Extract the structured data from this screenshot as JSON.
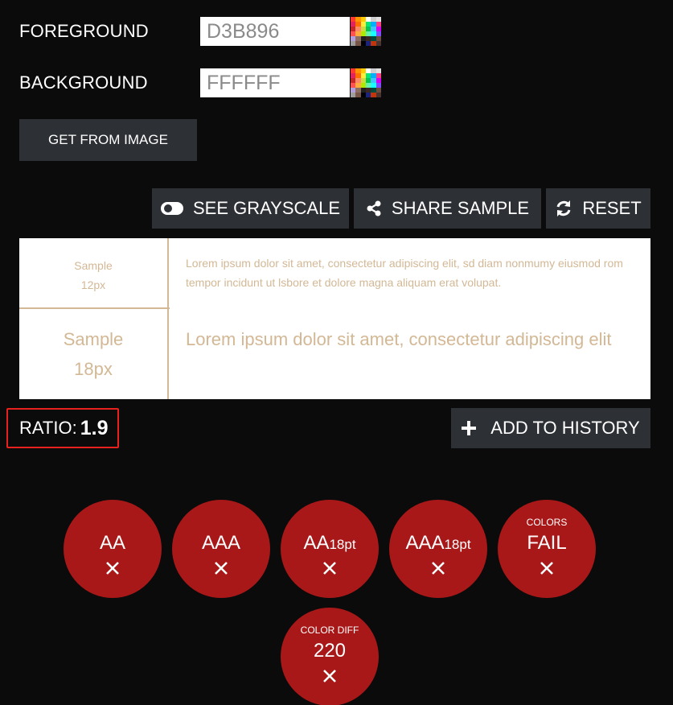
{
  "colors": {
    "foreground": "#D3B896",
    "background": "#FFFFFF",
    "page_bg": "#0b0b0b",
    "button_bg": "#2d3035",
    "fail_red": "#a91818",
    "highlight_red": "#e8201e"
  },
  "foreground": {
    "label": "FOREGROUND",
    "value": "D3B896"
  },
  "background": {
    "label": "BACKGROUND",
    "value": "FFFFFF"
  },
  "get_from_image": {
    "label": "GET FROM IMAGE"
  },
  "toolbar": {
    "grayscale": {
      "label": "SEE GRAYSCALE",
      "icon": "toggle-icon"
    },
    "share": {
      "label": "SHARE SAMPLE",
      "icon": "share-icon"
    },
    "reset": {
      "label": "RESET",
      "icon": "refresh-icon"
    }
  },
  "sample": {
    "small": {
      "label_line1": "Sample",
      "label_line2": "12px",
      "text": "Lorem ipsum dolor sit amet, consectetur adipiscing elit, sd diam nonmumy eiusmod rom tempor incidunt ut lsbore et dolore magna aliquam erat volupat."
    },
    "large": {
      "label_line1": "Sample",
      "label_line2": "18px",
      "text": "Lorem ipsum dolor sit amet, consectetur adipiscing elit"
    }
  },
  "ratio": {
    "label": "RATIO:",
    "value": "1.9"
  },
  "add_to_history": {
    "label": "ADD TO HISTORY",
    "icon": "plus-icon"
  },
  "results": [
    {
      "main": "AA",
      "sub": "",
      "top": "",
      "icon": "close-icon"
    },
    {
      "main": "AAA",
      "sub": "",
      "top": "",
      "icon": "close-icon"
    },
    {
      "main": "AA",
      "sub": "18pt",
      "top": "",
      "icon": "close-icon"
    },
    {
      "main": "AAA",
      "sub": "18pt",
      "top": "",
      "icon": "close-icon"
    },
    {
      "main": "FAIL",
      "sub": "",
      "top": "COLORS",
      "icon": "close-icon"
    },
    {
      "main": "220",
      "sub": "",
      "top": "COLOR DIFF",
      "icon": "close-icon"
    }
  ]
}
